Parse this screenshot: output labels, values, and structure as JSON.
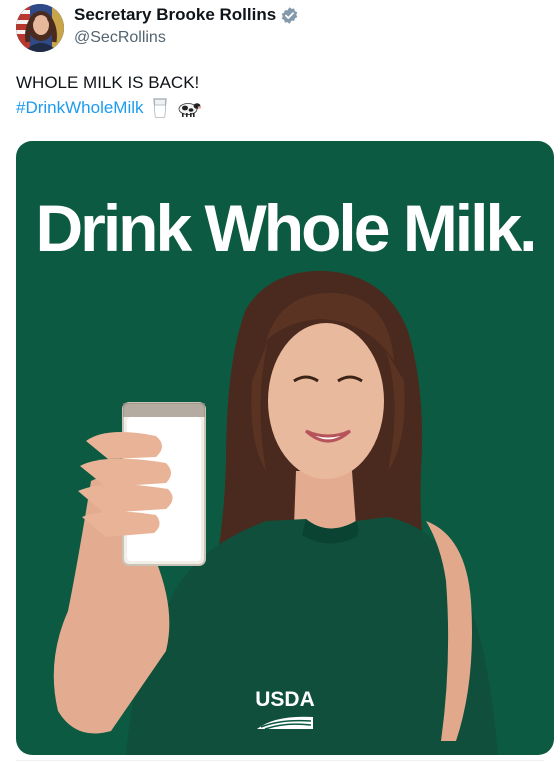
{
  "post": {
    "author": {
      "display_name": "Secretary Brooke Rollins",
      "handle": "@SecRollins",
      "verified_icon": "verified-badge-icon"
    },
    "text": "WHOLE MILK IS BACK!",
    "hashtag": "#DrinkWholeMilk",
    "emojis": [
      "glass-of-milk-icon",
      "cow-icon"
    ],
    "media": {
      "headline": "Drink Whole Milk.",
      "logo_text": "USDA",
      "background_color": "#0d5a42"
    }
  },
  "colors": {
    "link": "#1d9bf0",
    "secondary_text": "#536471",
    "verified": "#829aab"
  }
}
